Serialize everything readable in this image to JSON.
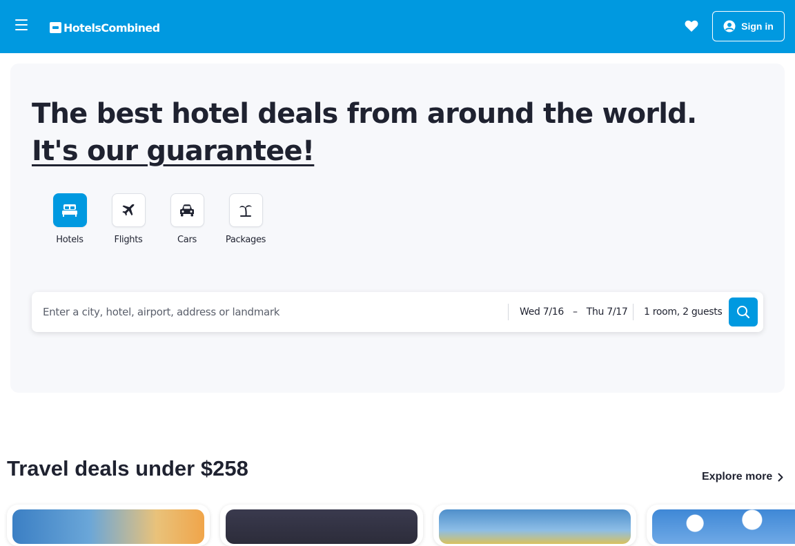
{
  "header": {
    "brand": "HotelsCombined",
    "sign_in_label": "Sign in"
  },
  "hero": {
    "headline_main": "The best hotel deals from around the world. ",
    "headline_link": "It's our guarantee!",
    "verticals": [
      {
        "label": "Hotels",
        "icon": "bed-icon",
        "active": true
      },
      {
        "label": "Flights",
        "icon": "plane-icon",
        "active": false
      },
      {
        "label": "Cars",
        "icon": "car-icon",
        "active": false
      },
      {
        "label": "Packages",
        "icon": "palm-tree-icon",
        "active": false
      }
    ],
    "search": {
      "placeholder": "Enter a city, hotel, airport, address or landmark",
      "checkin": "Wed 7/16",
      "dash": "–",
      "checkout": "Thu 7/17",
      "guests": "1 room, 2 guests"
    }
  },
  "deals": {
    "title": "Travel deals under $258",
    "explore_label": "Explore more"
  },
  "colors": {
    "brand_blue": "#0099e0",
    "hero_bg": "#f7f8fb",
    "text_dark": "#1f2230"
  }
}
